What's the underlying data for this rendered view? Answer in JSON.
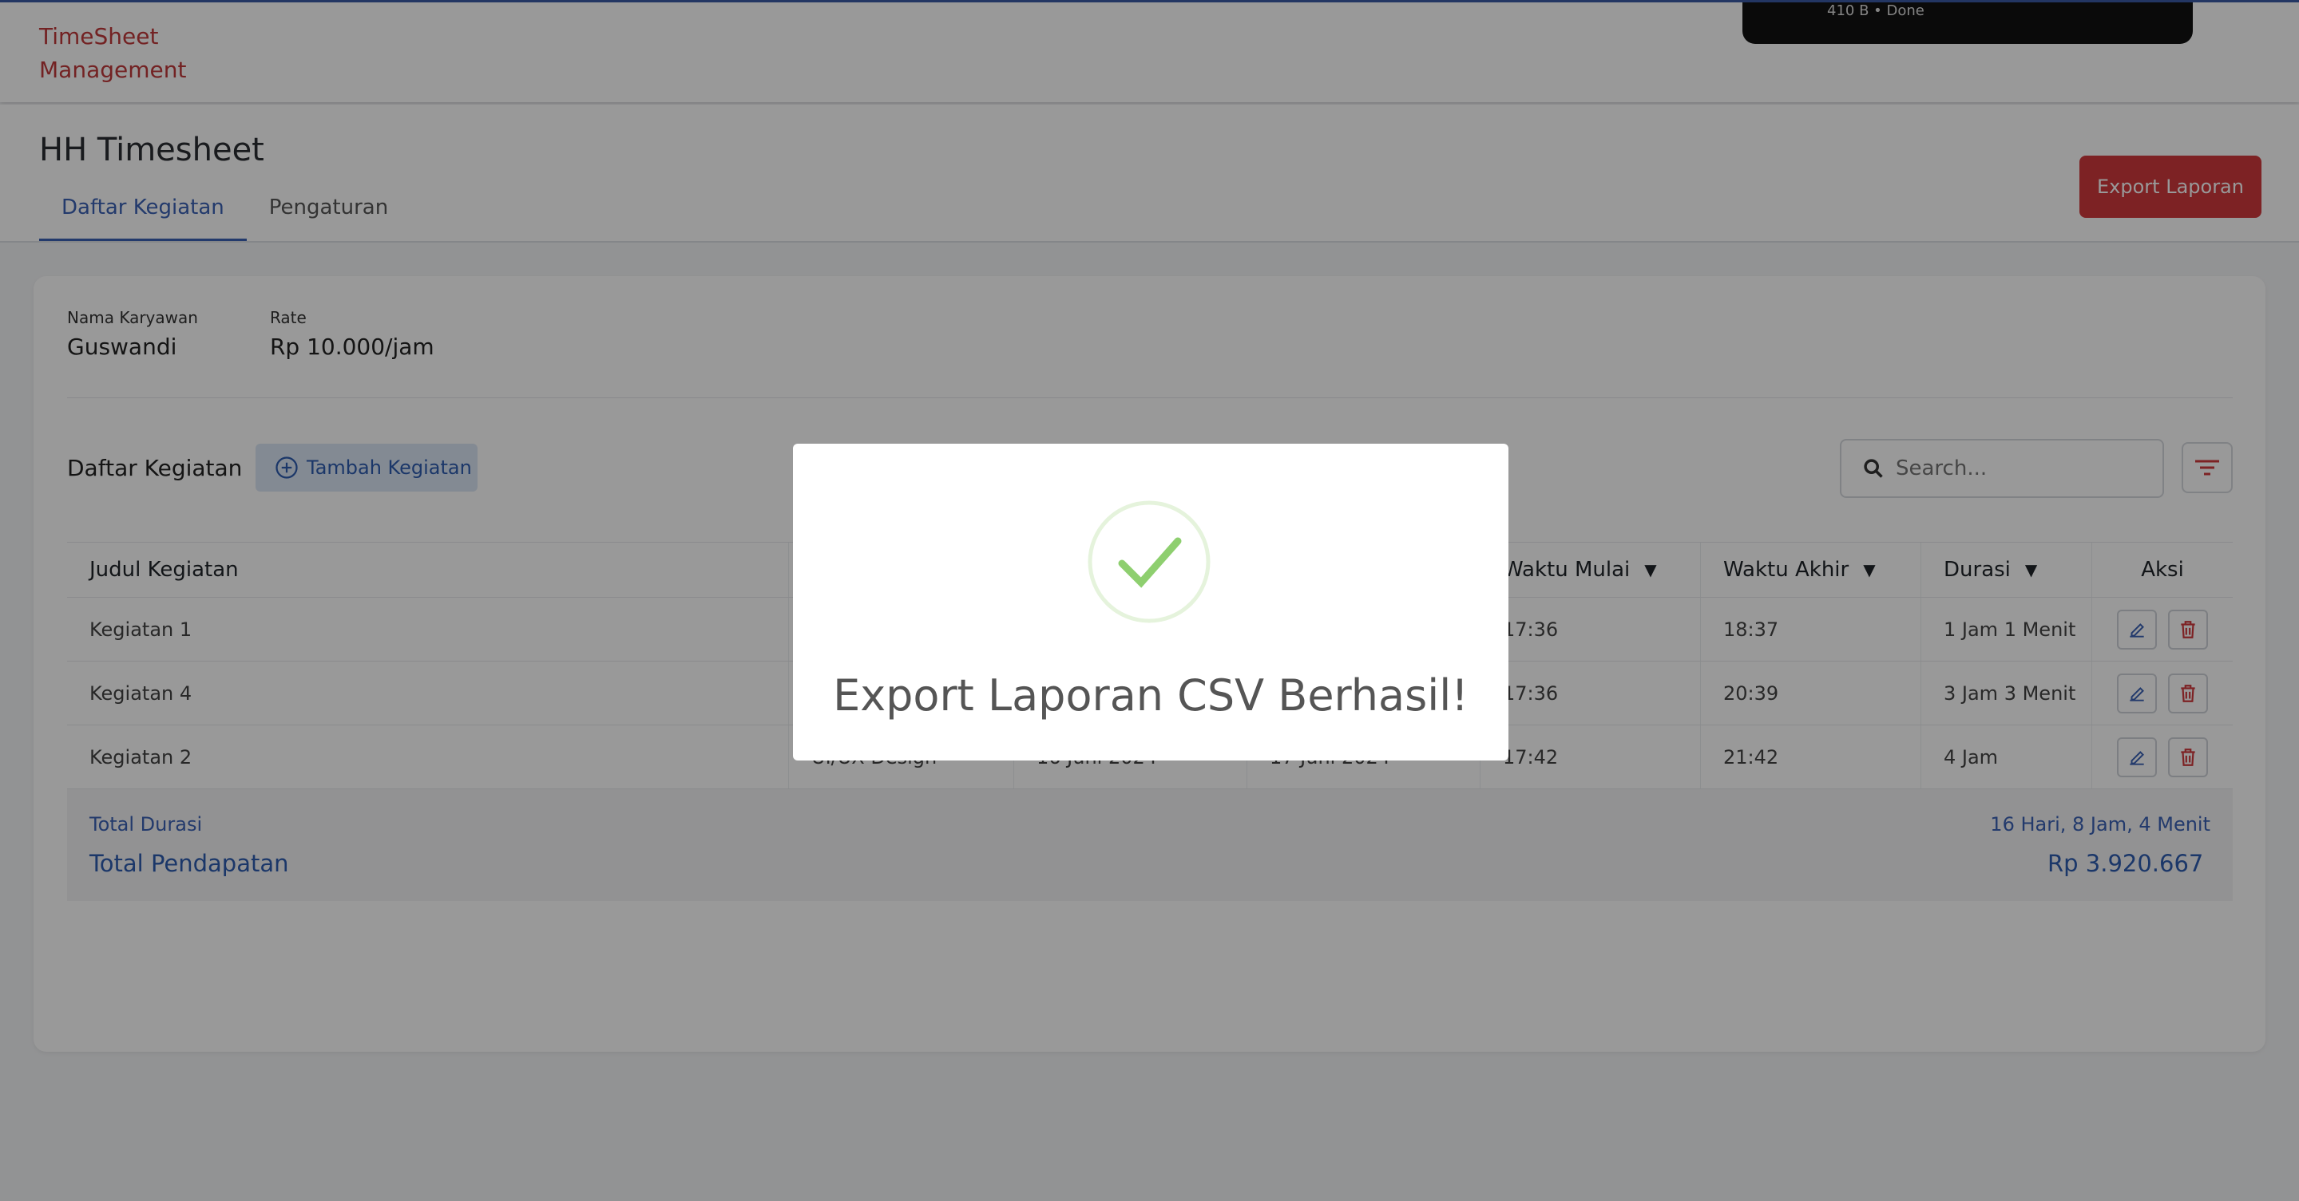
{
  "app": {
    "brand_line1": "TimeSheet",
    "brand_line2": "Management"
  },
  "download": {
    "status": "410 B • Done"
  },
  "header": {
    "title": "HH Timesheet",
    "tabs": [
      {
        "label": "Daftar Kegiatan",
        "active": true
      },
      {
        "label": "Pengaturan",
        "active": false
      }
    ],
    "export_label": "Export Laporan"
  },
  "employee": {
    "name_label": "Nama Karyawan",
    "name": "Guswandi",
    "rate_label": "Rate",
    "rate": "Rp 10.000/jam"
  },
  "list": {
    "title": "Daftar Kegiatan",
    "add_label": "Tambah Kegiatan",
    "search_placeholder": "Search..."
  },
  "table": {
    "columns": [
      "Judul Kegiatan",
      "",
      "",
      "",
      "Waktu Mulai",
      "Waktu Akhir",
      "Durasi",
      "Aksi"
    ],
    "rows": [
      {
        "title": "Kegiatan 1",
        "c1": "",
        "c2": "",
        "c3": "",
        "start": "17:36",
        "end": "18:37",
        "duration": "1 Jam 1 Menit"
      },
      {
        "title": "Kegiatan 4",
        "c1": "",
        "c2": "",
        "c3": "",
        "start": "17:36",
        "end": "20:39",
        "duration": "3 Jam 3 Menit"
      },
      {
        "title": "Kegiatan 2",
        "c1": "UI/UX Design",
        "c2": "16 Juni 2024",
        "c3": "17 Juni 2024",
        "start": "17:42",
        "end": "21:42",
        "duration": "4 Jam"
      }
    ],
    "total_duration_label": "Total Durasi",
    "total_duration": "16 Hari, 8 Jam, 4 Menit",
    "total_income_label": "Total Pendapatan",
    "total_income": "Rp 3.920.667"
  },
  "modal": {
    "title": "Export Laporan CSV Berhasil!"
  },
  "colors": {
    "brand": "#c0393b",
    "primary": "#3b62b5",
    "danger": "#d0393c",
    "success": "#8ecf6f"
  }
}
